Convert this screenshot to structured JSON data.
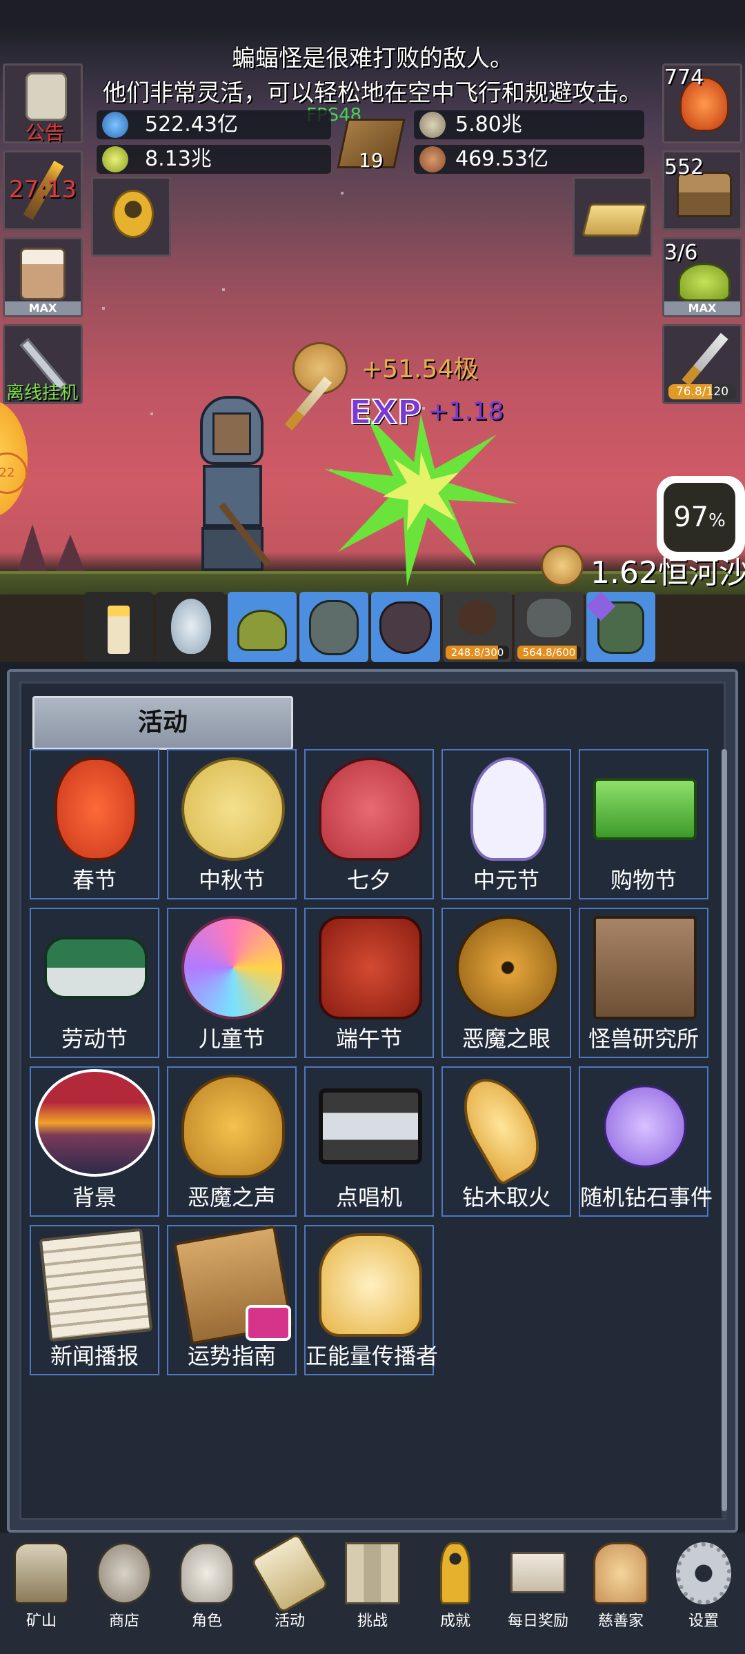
{
  "scene": {
    "message_line1": "蝙蝠怪是很难打败的敌人。",
    "message_line2": "他们非常灵活，可以轻松地在空中飞行和规避攻击。",
    "fps": "FPS48",
    "book_count": "19",
    "resources": {
      "blue_potion": "522.43亿",
      "coin_stack": "5.80兆",
      "green_potion": "8.13兆",
      "meat": "469.53亿"
    },
    "left": {
      "notice_label": "公告",
      "torch_timer": "27:13",
      "drink_max": "MAX",
      "offline_label": "离线挂机"
    },
    "right": {
      "potion_count": "774",
      "chest_count": "552",
      "slime_count": "3/6",
      "slime_max": "MAX",
      "sword_progress_text": "76.8/120",
      "sword_progress_fraction": 0.64
    },
    "floating": {
      "gold_gain": "+51.54极",
      "exp_label": "EXP",
      "exp_gain": "+1.18",
      "coin_total": "1.62恒河沙",
      "percent": "97",
      "percent_unit": "%",
      "side_timer": "22"
    },
    "monster_bars": {
      "spider": {
        "text": "248.8/300",
        "fraction": 0.83
      },
      "ghost": {
        "text": "564.8/600",
        "fraction": 0.94
      }
    }
  },
  "panel": {
    "tab_title": "活动",
    "items": [
      {
        "label": "春节",
        "icon": "lantern-icon"
      },
      {
        "label": "中秋节",
        "icon": "moon-icon"
      },
      {
        "label": "七夕",
        "icon": "heart-icon"
      },
      {
        "label": "中元节",
        "icon": "ghost-icon"
      },
      {
        "label": "购物节",
        "icon": "cash-icon"
      },
      {
        "label": "劳动节",
        "icon": "brush-icon"
      },
      {
        "label": "儿童节",
        "icon": "lollipop-icon"
      },
      {
        "label": "端午节",
        "icon": "dragon-mask-icon"
      },
      {
        "label": "恶魔之眼",
        "icon": "demon-eye-icon"
      },
      {
        "label": "怪兽研究所",
        "icon": "lab-crate-icon"
      },
      {
        "label": "背景",
        "icon": "sunset-icon"
      },
      {
        "label": "恶魔之声",
        "icon": "bell-icon"
      },
      {
        "label": "点唱机",
        "icon": "cassette-icon"
      },
      {
        "label": "钻木取火",
        "icon": "fire-stick-icon"
      },
      {
        "label": "随机钻石事件",
        "icon": "diamond-icon"
      },
      {
        "label": "新闻播报",
        "icon": "newspaper-icon"
      },
      {
        "label": "运势指南",
        "icon": "fortune-scroll-icon"
      },
      {
        "label": "正能量传播者",
        "icon": "crown-icon"
      }
    ]
  },
  "nav": [
    {
      "label": "矿山",
      "icon": "lantern-icon"
    },
    {
      "label": "商店",
      "icon": "fossil-icon"
    },
    {
      "label": "角色",
      "icon": "skull-icon"
    },
    {
      "label": "活动",
      "icon": "scroll-icon"
    },
    {
      "label": "挑战",
      "icon": "map-icon"
    },
    {
      "label": "成就",
      "icon": "key-icon"
    },
    {
      "label": "每日奖励",
      "icon": "letter-icon"
    },
    {
      "label": "慈善家",
      "icon": "bread-icon"
    },
    {
      "label": "设置",
      "icon": "gear-icon"
    }
  ]
}
